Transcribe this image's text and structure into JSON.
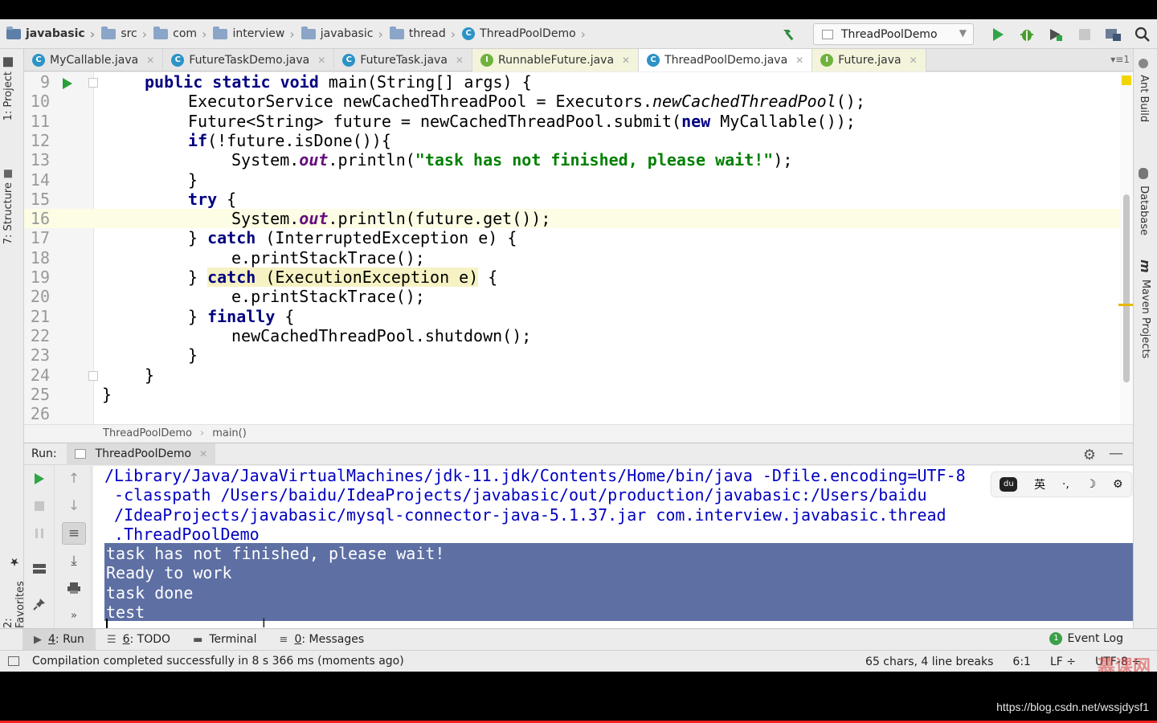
{
  "breadcrumbs": [
    "javabasic",
    "src",
    "com",
    "interview",
    "javabasic",
    "thread",
    "ThreadPoolDemo"
  ],
  "run_config": "ThreadPoolDemo",
  "tabs": [
    {
      "label": "MyCallable.java",
      "type": "C"
    },
    {
      "label": "FutureTaskDemo.java",
      "type": "C"
    },
    {
      "label": "FutureTask.java",
      "type": "C"
    },
    {
      "label": "RunnableFuture.java",
      "type": "I"
    },
    {
      "label": "ThreadPoolDemo.java",
      "type": "C",
      "active": true
    },
    {
      "label": "Future.java",
      "type": "I"
    }
  ],
  "tab_overflow": "▾≡1",
  "left_strip": {
    "project": "1: Project",
    "structure": "7: Structure",
    "favorites": "2: Favorites"
  },
  "right_strip": {
    "ant": "Ant Build",
    "database": "Database",
    "maven": "Maven Projects",
    "maven_icon": "m"
  },
  "editor": {
    "line_numbers": [
      "9",
      "10",
      "11",
      "12",
      "13",
      "14",
      "15",
      "16",
      "17",
      "18",
      "19",
      "20",
      "21",
      "22",
      "23",
      "24",
      "25",
      "26"
    ],
    "highlight_line": "16",
    "breadcrumb": [
      "ThreadPoolDemo",
      "main()"
    ]
  },
  "run_panel": {
    "label": "Run:",
    "tab": "ThreadPoolDemo",
    "console_cmd": [
      "/Library/Java/JavaVirtualMachines/jdk-11.jdk/Contents/Home/bin/java -Dfile.encoding=UTF-8",
      " -classpath /Users/baidu/IdeaProjects/javabasic/out/production/javabasic:/Users/baidu",
      " /IdeaProjects/javabasic/mysql-connector-java-5.1.37.jar com.interview.javabasic.thread",
      " .ThreadPoolDemo"
    ],
    "console_output": [
      "task has not finished, please wait!",
      "Ready to work",
      "task done",
      "test"
    ],
    "ime": {
      "paw": "du",
      "lang": "英",
      "punct": "·,",
      "moon": "☽",
      "gear": "⚙"
    }
  },
  "bottom_tabs": [
    {
      "num": "4",
      "label": ": Run"
    },
    {
      "num": "6",
      "label": ": TODO"
    },
    {
      "num": "",
      "label": "Terminal"
    },
    {
      "num": "0",
      "label": ": Messages"
    }
  ],
  "event_log": {
    "count": "1",
    "label": "Event Log"
  },
  "status": {
    "message": "Compilation completed successfully in 8 s 366 ms (moments ago)",
    "chars": "65 chars, 4 line breaks",
    "position": "6:1",
    "line_sep": "LF ÷",
    "encoding": "UTF-8 ÷"
  },
  "watermark": "慕课网",
  "caption": "https://blog.csdn.net/wssjdysf1"
}
